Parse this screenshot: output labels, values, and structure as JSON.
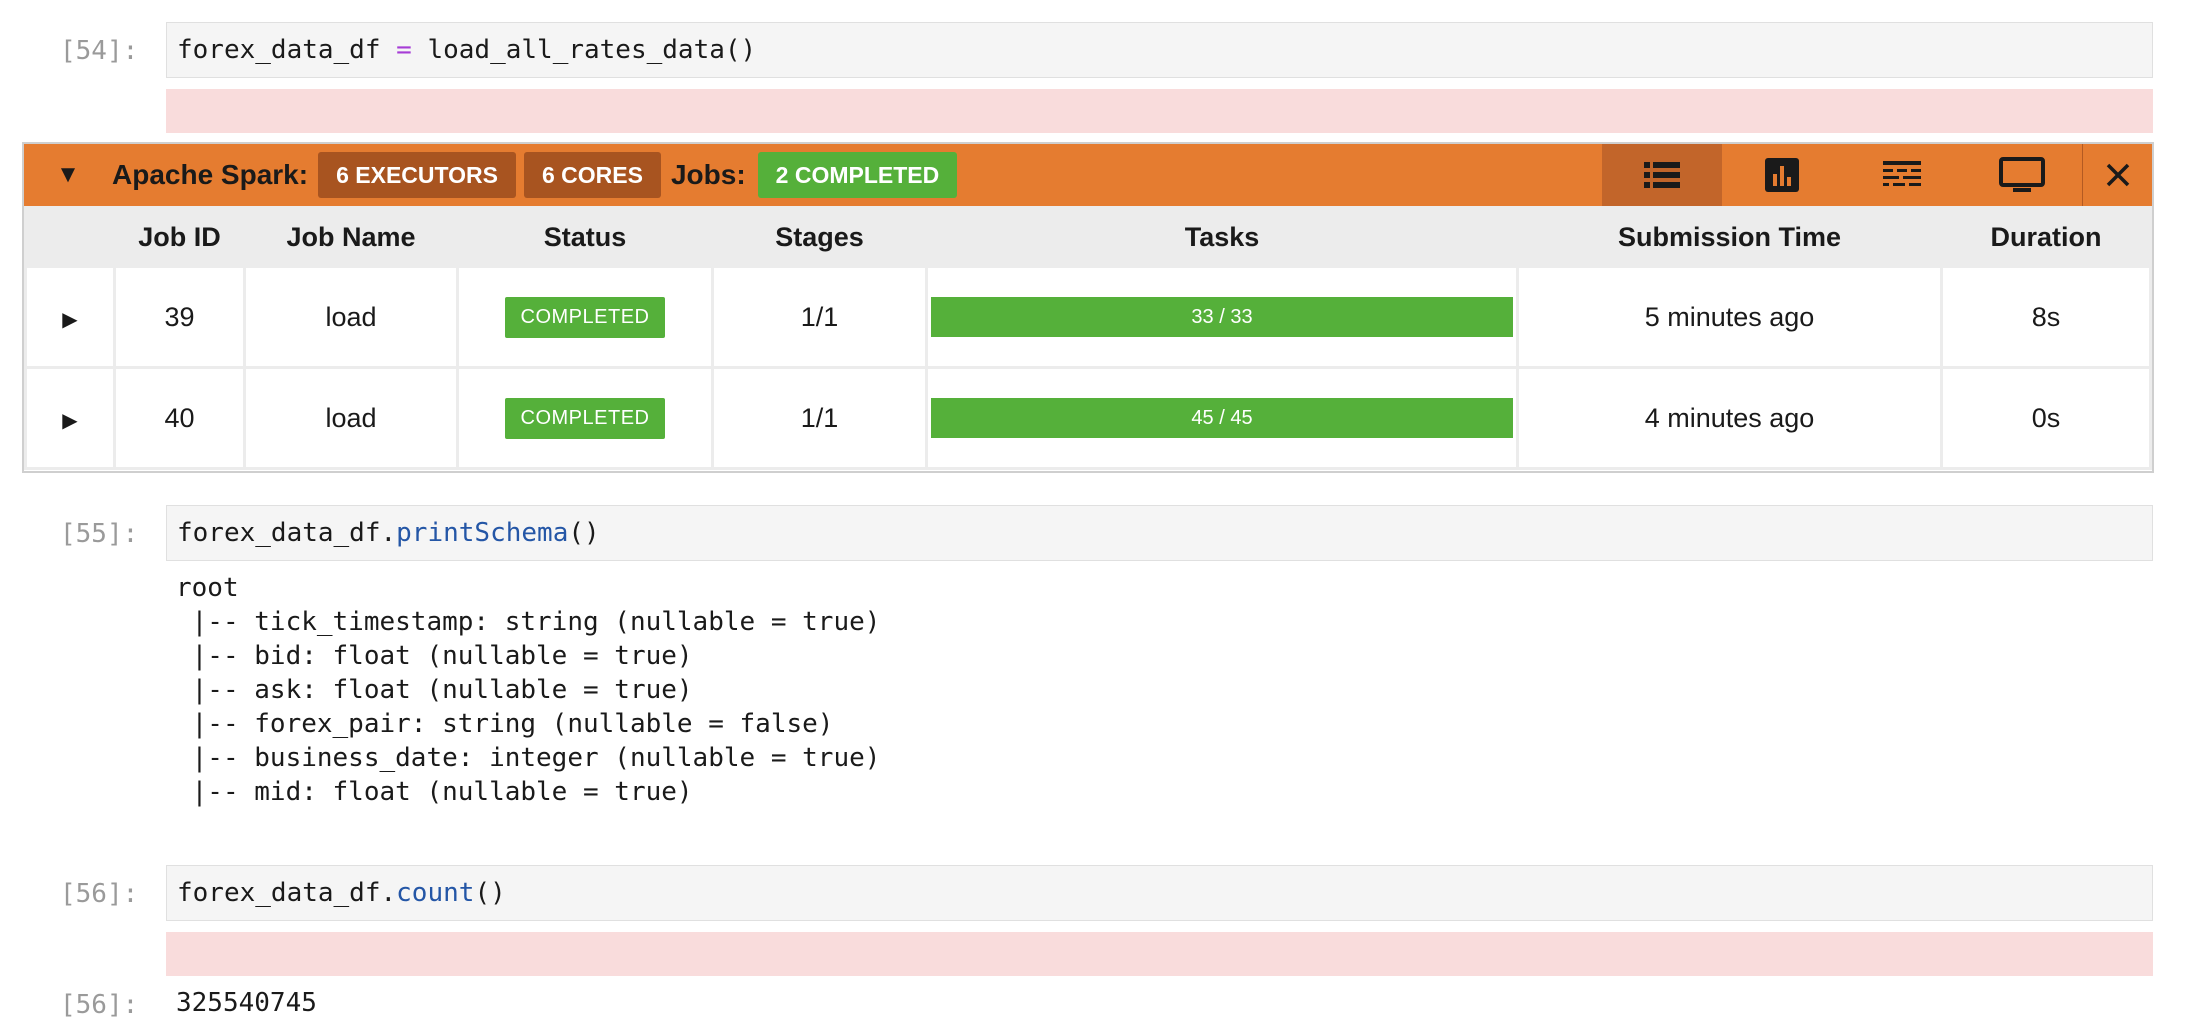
{
  "cells": [
    {
      "prompt": "[54]:",
      "code": {
        "pre": "forex_data_df ",
        "op": "=",
        "post": " load_all_rates_data()"
      }
    },
    {
      "prompt": "[55]:",
      "code": {
        "pre": "forex_data_df.",
        "fn": "printSchema",
        "post": "()"
      },
      "output": "root\n |-- tick_timestamp: string (nullable = true)\n |-- bid: float (nullable = true)\n |-- ask: float (nullable = true)\n |-- forex_pair: string (nullable = false)\n |-- business_date: integer (nullable = true)\n |-- mid: float (nullable = true)"
    },
    {
      "prompt": "[56]:",
      "code": {
        "pre": "forex_data_df.",
        "fn": "count",
        "post": "()"
      }
    },
    {
      "prompt": "[56]:",
      "output": "325540745"
    }
  ],
  "spark": {
    "title": "Apache Spark:",
    "executors": "6 EXECUTORS",
    "cores": "6 CORES",
    "jobs_label": "Jobs:",
    "jobs_status": "2 COMPLETED",
    "toolbar": [
      "list-icon",
      "bar-chart-icon",
      "timeline-icon",
      "monitor-icon",
      "close-icon"
    ],
    "columns": [
      "",
      "Job ID",
      "Job Name",
      "Status",
      "Stages",
      "Tasks",
      "Submission Time",
      "Duration"
    ],
    "rows": [
      {
        "id": "39",
        "name": "load",
        "status": "COMPLETED",
        "stages": "1/1",
        "tasks": "33 / 33",
        "tasks_fraction": 1.0,
        "submitted": "5 minutes ago",
        "duration": "8s"
      },
      {
        "id": "40",
        "name": "load",
        "status": "COMPLETED",
        "stages": "1/1",
        "tasks": "45 / 45",
        "tasks_fraction": 1.0,
        "submitted": "4 minutes ago",
        "duration": "0s"
      }
    ],
    "colors": {
      "header": "#e57c30",
      "badge_dark": "#a85420",
      "success": "#55b03a"
    }
  }
}
